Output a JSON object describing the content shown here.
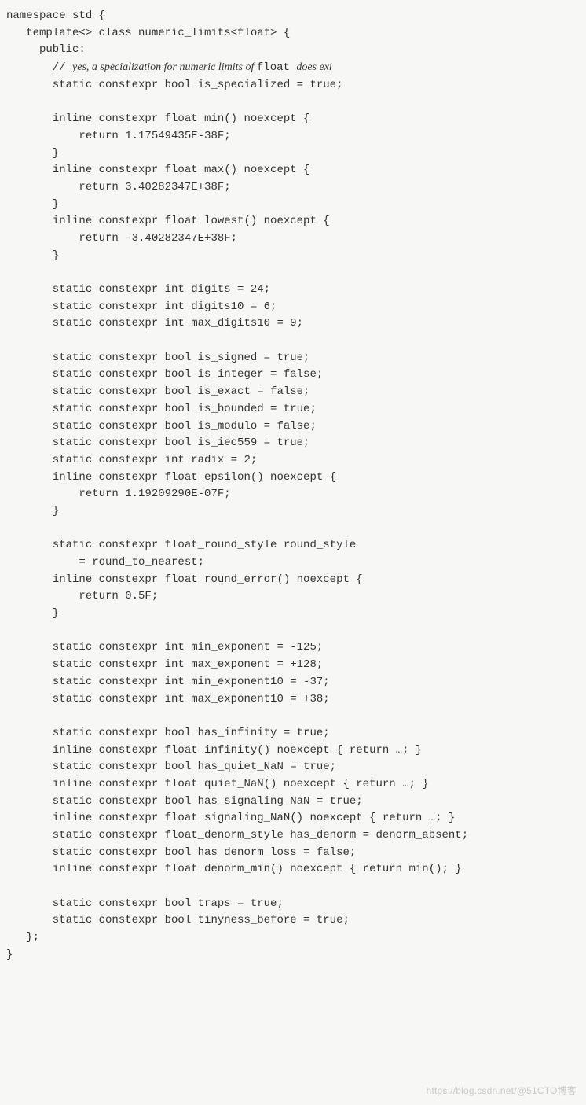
{
  "code": {
    "l01": "namespace std {",
    "l02": "   template<> class numeric_limits<float> {",
    "l03": "     public:",
    "comment_prefix": "       // ",
    "comment_i1": "yes, a specialization for numeric limits of ",
    "comment_c1": "float ",
    "comment_i2": "does exi",
    "l05": "       static constexpr bool is_specialized = true;",
    "blank": "",
    "l06": "       inline constexpr float min() noexcept {",
    "l07": "           return 1.17549435E-38F;",
    "l08": "       }",
    "l09": "       inline constexpr float max() noexcept {",
    "l10": "           return 3.40282347E+38F;",
    "l11": "       }",
    "l12": "       inline constexpr float lowest() noexcept {",
    "l13": "           return -3.40282347E+38F;",
    "l14": "       }",
    "l15": "       static constexpr int digits = 24;",
    "l16": "       static constexpr int digits10 = 6;",
    "l17": "       static constexpr int max_digits10 = 9;",
    "l18": "       static constexpr bool is_signed = true;",
    "l19": "       static constexpr bool is_integer = false;",
    "l20": "       static constexpr bool is_exact = false;",
    "l21": "       static constexpr bool is_bounded = true;",
    "l22": "       static constexpr bool is_modulo = false;",
    "l23": "       static constexpr bool is_iec559 = true;",
    "l24": "       static constexpr int radix = 2;",
    "l25": "       inline constexpr float epsilon() noexcept {",
    "l26": "           return 1.19209290E-07F;",
    "l27": "       }",
    "l28": "       static constexpr float_round_style round_style",
    "l29": "           = round_to_nearest;",
    "l30": "       inline constexpr float round_error() noexcept {",
    "l31": "           return 0.5F;",
    "l32": "       }",
    "l33": "       static constexpr int min_exponent = -125;",
    "l34": "       static constexpr int max_exponent = +128;",
    "l35": "       static constexpr int min_exponent10 = -37;",
    "l36": "       static constexpr int max_exponent10 = +38;",
    "l37": "       static constexpr bool has_infinity = true;",
    "l38": "       inline constexpr float infinity() noexcept { return …; }",
    "l39": "       static constexpr bool has_quiet_NaN = true;",
    "l40": "       inline constexpr float quiet_NaN() noexcept { return …; }",
    "l41": "       static constexpr bool has_signaling_NaN = true;",
    "l42": "       inline constexpr float signaling_NaN() noexcept { return …; }",
    "l43": "       static constexpr float_denorm_style has_denorm = denorm_absent;",
    "l44": "       static constexpr bool has_denorm_loss = false;",
    "l45": "       inline constexpr float denorm_min() noexcept { return min(); }",
    "l46": "       static constexpr bool traps = true;",
    "l47": "       static constexpr bool tinyness_before = true;",
    "l48": "   };",
    "l49": "}"
  },
  "watermark": "https://blog.csdn.net/@51CTO博客"
}
